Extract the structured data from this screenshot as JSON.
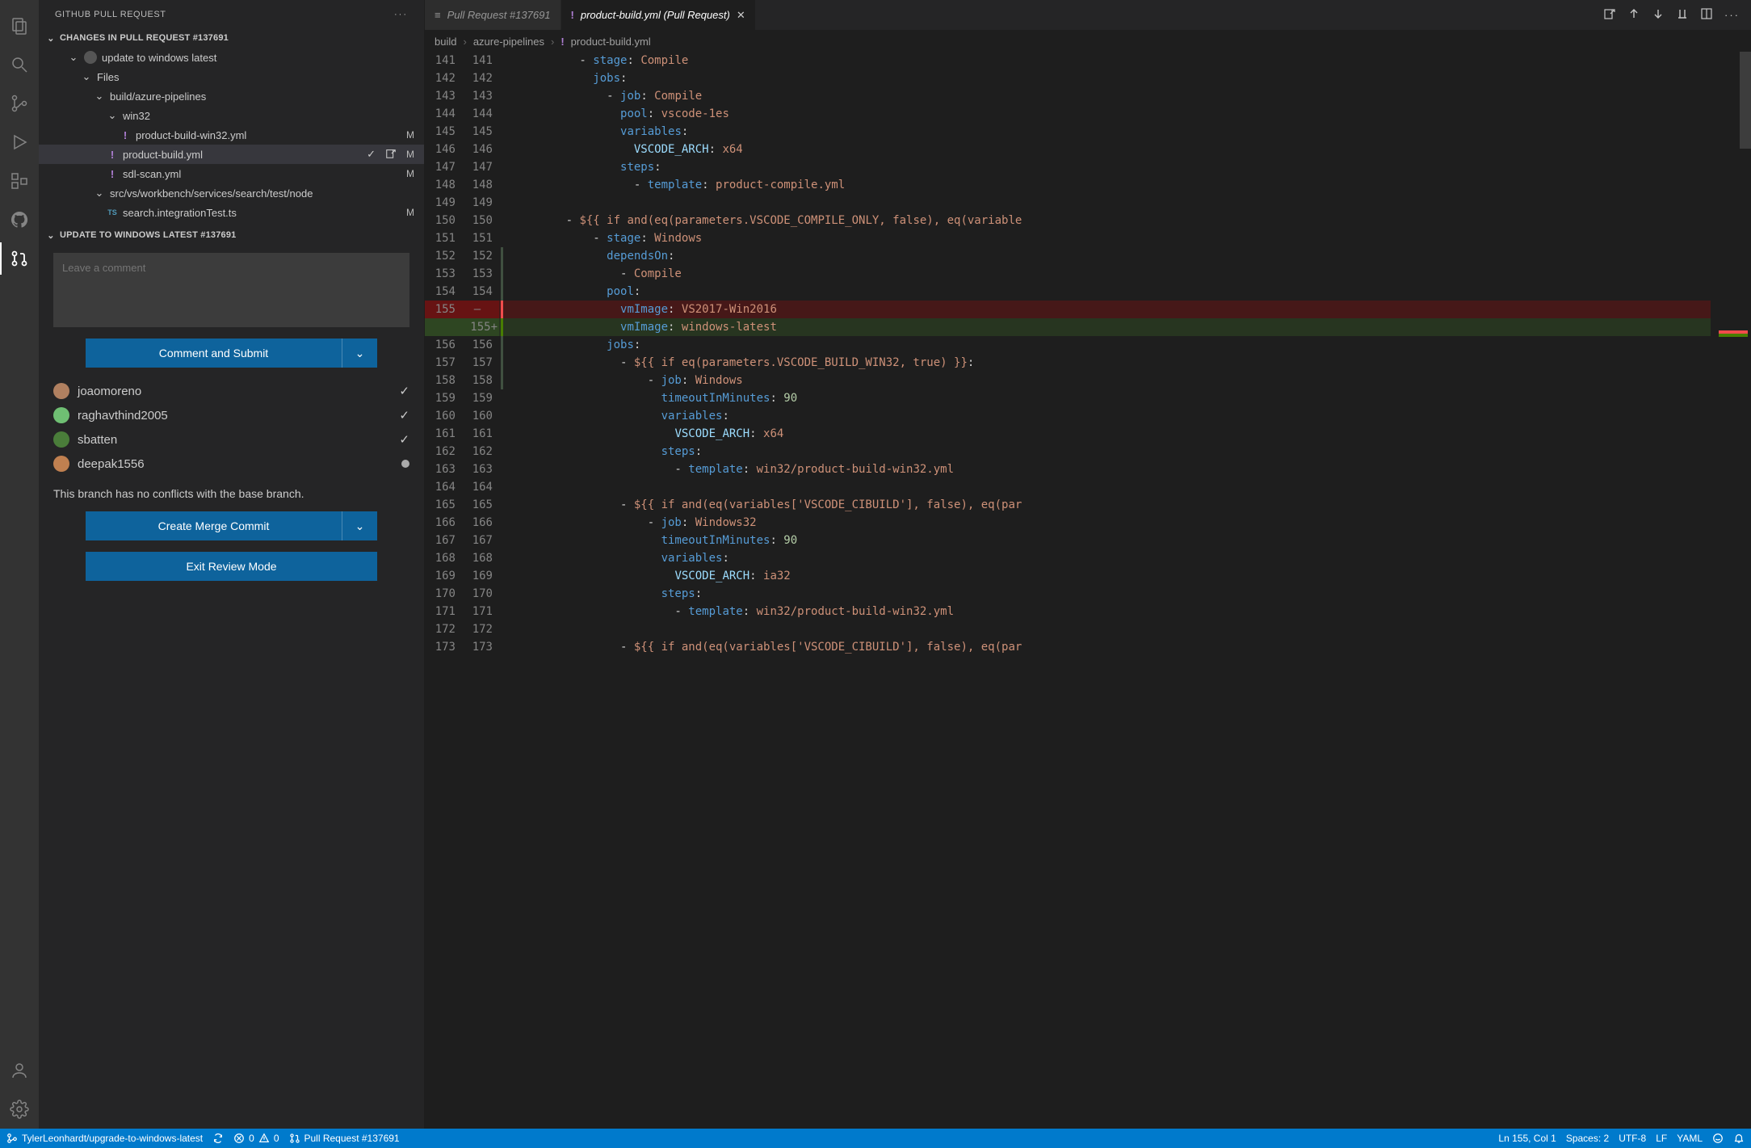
{
  "sidebar": {
    "title": "GITHUB PULL REQUEST",
    "changes_header": "CHANGES IN PULL REQUEST #137691",
    "pr_title": "update to windows latest",
    "files_label": "Files",
    "folders": {
      "build_pipelines": "build/azure-pipelines",
      "win32": "win32",
      "src_node": "src/vs/workbench/services/search/test/node"
    },
    "files": [
      {
        "name": "product-build-win32.yml",
        "status": "M",
        "icon": "!"
      },
      {
        "name": "product-build.yml",
        "status": "M",
        "icon": "!",
        "selected": true,
        "actions": true
      },
      {
        "name": "sdl-scan.yml",
        "status": "M",
        "icon": "!"
      },
      {
        "name": "search.integrationTest.ts",
        "status": "M",
        "icon": "TS"
      }
    ],
    "detail_header": "UPDATE TO WINDOWS LATEST #137691",
    "comment_placeholder": "Leave a comment",
    "comment_submit": "Comment and Submit",
    "reviewers": [
      {
        "name": "joaomoreno",
        "state": "check"
      },
      {
        "name": "raghavthind2005",
        "state": "check"
      },
      {
        "name": "sbatten",
        "state": "check"
      },
      {
        "name": "deepak1556",
        "state": "dot"
      }
    ],
    "no_conflicts": "This branch has no conflicts with the base branch.",
    "merge_btn": "Create Merge Commit",
    "exit_btn": "Exit Review Mode"
  },
  "tabs": {
    "inactive": "Pull Request #137691",
    "active": "product-build.yml (Pull Request)"
  },
  "breadcrumb": {
    "a": "build",
    "b": "azure-pipelines",
    "c": "product-build.yml"
  },
  "code": [
    {
      "l": 141,
      "r": 141,
      "t": "context removed-context",
      "tokens": [
        [
          "plain",
          "        - "
        ],
        [
          "key",
          "stage"
        ],
        [
          "punc",
          ": "
        ],
        [
          "str",
          "Compile"
        ]
      ]
    },
    {
      "l": 142,
      "r": 142,
      "tokens": [
        [
          "plain",
          "          "
        ],
        [
          "key",
          "jobs"
        ],
        [
          "punc",
          ":"
        ]
      ]
    },
    {
      "l": 143,
      "r": 143,
      "tokens": [
        [
          "plain",
          "            - "
        ],
        [
          "key",
          "job"
        ],
        [
          "punc",
          ": "
        ],
        [
          "str",
          "Compile"
        ]
      ]
    },
    {
      "l": 144,
      "r": 144,
      "tokens": [
        [
          "plain",
          "              "
        ],
        [
          "key",
          "pool"
        ],
        [
          "punc",
          ": "
        ],
        [
          "str",
          "vscode-1es"
        ]
      ]
    },
    {
      "l": 145,
      "r": 145,
      "tokens": [
        [
          "plain",
          "              "
        ],
        [
          "key",
          "variables"
        ],
        [
          "punc",
          ":"
        ]
      ]
    },
    {
      "l": 146,
      "r": 146,
      "tokens": [
        [
          "plain",
          "                "
        ],
        [
          "var",
          "VSCODE_ARCH"
        ],
        [
          "punc",
          ": "
        ],
        [
          "str",
          "x64"
        ]
      ]
    },
    {
      "l": 147,
      "r": 147,
      "tokens": [
        [
          "plain",
          "              "
        ],
        [
          "key",
          "steps"
        ],
        [
          "punc",
          ":"
        ]
      ]
    },
    {
      "l": 148,
      "r": 148,
      "tokens": [
        [
          "plain",
          "                - "
        ],
        [
          "key",
          "template"
        ],
        [
          "punc",
          ": "
        ],
        [
          "str",
          "product-compile.yml"
        ]
      ]
    },
    {
      "l": 149,
      "r": 149,
      "tokens": [
        [
          "plain",
          ""
        ]
      ]
    },
    {
      "l": 150,
      "r": 150,
      "tokens": [
        [
          "plain",
          "      - "
        ],
        [
          "str",
          "${{ if and(eq(parameters.VSCODE_COMPILE_ONLY, false), eq(variable"
        ]
      ]
    },
    {
      "l": 151,
      "r": 151,
      "tokens": [
        [
          "plain",
          "          - "
        ],
        [
          "key",
          "stage"
        ],
        [
          "punc",
          ": "
        ],
        [
          "str",
          "Windows"
        ]
      ]
    },
    {
      "l": 152,
      "r": 152,
      "mark": "ctx",
      "tokens": [
        [
          "plain",
          "            "
        ],
        [
          "key",
          "dependsOn"
        ],
        [
          "punc",
          ":"
        ]
      ]
    },
    {
      "l": 153,
      "r": 153,
      "mark": "ctx",
      "tokens": [
        [
          "plain",
          "              - "
        ],
        [
          "str",
          "Compile"
        ]
      ]
    },
    {
      "l": 154,
      "r": 154,
      "mark": "ctx",
      "tokens": [
        [
          "plain",
          "            "
        ],
        [
          "key",
          "pool"
        ],
        [
          "punc",
          ":"
        ]
      ]
    },
    {
      "l": 155,
      "r": null,
      "kind": "removed",
      "tokens": [
        [
          "plain",
          "              "
        ],
        [
          "key",
          "vmImage"
        ],
        [
          "punc",
          ": "
        ],
        [
          "str",
          "VS2017-Win2016"
        ]
      ]
    },
    {
      "l": null,
      "r": 155,
      "kind": "added",
      "tokens": [
        [
          "plain",
          "              "
        ],
        [
          "key",
          "vmImage"
        ],
        [
          "punc",
          ": "
        ],
        [
          "str",
          "windows-latest"
        ]
      ]
    },
    {
      "l": 156,
      "r": 156,
      "mark": "ctx",
      "tokens": [
        [
          "plain",
          "            "
        ],
        [
          "key",
          "jobs"
        ],
        [
          "punc",
          ":"
        ]
      ]
    },
    {
      "l": 157,
      "r": 157,
      "mark": "ctx",
      "tokens": [
        [
          "plain",
          "              - "
        ],
        [
          "str",
          "${{ if eq(parameters.VSCODE_BUILD_WIN32, true) }}"
        ],
        [
          "punc",
          ":"
        ]
      ]
    },
    {
      "l": 158,
      "r": 158,
      "mark": "ctx",
      "tokens": [
        [
          "plain",
          "                  - "
        ],
        [
          "key",
          "job"
        ],
        [
          "punc",
          ": "
        ],
        [
          "str",
          "Windows"
        ]
      ]
    },
    {
      "l": 159,
      "r": 159,
      "tokens": [
        [
          "plain",
          "                    "
        ],
        [
          "key",
          "timeoutInMinutes"
        ],
        [
          "punc",
          ": "
        ],
        [
          "num",
          "90"
        ]
      ]
    },
    {
      "l": 160,
      "r": 160,
      "tokens": [
        [
          "plain",
          "                    "
        ],
        [
          "key",
          "variables"
        ],
        [
          "punc",
          ":"
        ]
      ]
    },
    {
      "l": 161,
      "r": 161,
      "tokens": [
        [
          "plain",
          "                      "
        ],
        [
          "var",
          "VSCODE_ARCH"
        ],
        [
          "punc",
          ": "
        ],
        [
          "str",
          "x64"
        ]
      ]
    },
    {
      "l": 162,
      "r": 162,
      "tokens": [
        [
          "plain",
          "                    "
        ],
        [
          "key",
          "steps"
        ],
        [
          "punc",
          ":"
        ]
      ]
    },
    {
      "l": 163,
      "r": 163,
      "tokens": [
        [
          "plain",
          "                      - "
        ],
        [
          "key",
          "template"
        ],
        [
          "punc",
          ": "
        ],
        [
          "str",
          "win32/product-build-win32.yml"
        ]
      ]
    },
    {
      "l": 164,
      "r": 164,
      "tokens": [
        [
          "plain",
          ""
        ]
      ]
    },
    {
      "l": 165,
      "r": 165,
      "tokens": [
        [
          "plain",
          "              - "
        ],
        [
          "str",
          "${{ if and(eq(variables['VSCODE_CIBUILD'], false), eq(par"
        ]
      ]
    },
    {
      "l": 166,
      "r": 166,
      "tokens": [
        [
          "plain",
          "                  - "
        ],
        [
          "key",
          "job"
        ],
        [
          "punc",
          ": "
        ],
        [
          "str",
          "Windows32"
        ]
      ]
    },
    {
      "l": 167,
      "r": 167,
      "tokens": [
        [
          "plain",
          "                    "
        ],
        [
          "key",
          "timeoutInMinutes"
        ],
        [
          "punc",
          ": "
        ],
        [
          "num",
          "90"
        ]
      ]
    },
    {
      "l": 168,
      "r": 168,
      "tokens": [
        [
          "plain",
          "                    "
        ],
        [
          "key",
          "variables"
        ],
        [
          "punc",
          ":"
        ]
      ]
    },
    {
      "l": 169,
      "r": 169,
      "tokens": [
        [
          "plain",
          "                      "
        ],
        [
          "var",
          "VSCODE_ARCH"
        ],
        [
          "punc",
          ": "
        ],
        [
          "str",
          "ia32"
        ]
      ]
    },
    {
      "l": 170,
      "r": 170,
      "tokens": [
        [
          "plain",
          "                    "
        ],
        [
          "key",
          "steps"
        ],
        [
          "punc",
          ":"
        ]
      ]
    },
    {
      "l": 171,
      "r": 171,
      "tokens": [
        [
          "plain",
          "                      - "
        ],
        [
          "key",
          "template"
        ],
        [
          "punc",
          ": "
        ],
        [
          "str",
          "win32/product-build-win32.yml"
        ]
      ]
    },
    {
      "l": 172,
      "r": 172,
      "tokens": [
        [
          "plain",
          ""
        ]
      ]
    },
    {
      "l": 173,
      "r": 173,
      "tokens": [
        [
          "plain",
          "              - "
        ],
        [
          "str",
          "${{ if and(eq(variables['VSCODE_CIBUILD'], false), eq(par"
        ]
      ]
    }
  ],
  "status": {
    "branch": "TylerLeonhardt/upgrade-to-windows-latest",
    "errors": "0",
    "warnings": "0",
    "pr": "Pull Request #137691",
    "ln": "Ln 155, Col 1",
    "spaces": "Spaces: 2",
    "enc": "UTF-8",
    "eol": "LF",
    "lang": "YAML"
  }
}
